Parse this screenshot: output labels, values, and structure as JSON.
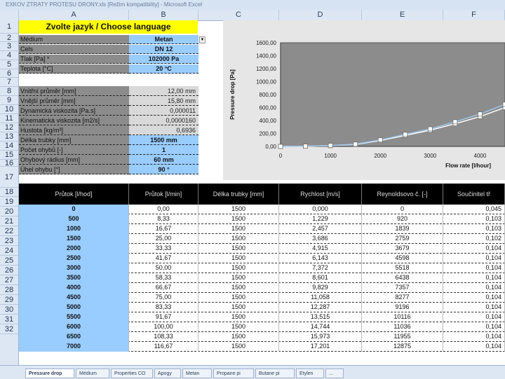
{
  "window_title": "EXKOV  ZTRATY  PROTESU  DRONY.xls [Režim kompatibility] - Microsoft Excel",
  "columns": [
    "A",
    "B",
    "C",
    "D",
    "E",
    "F"
  ],
  "row_numbers": [
    "1",
    "2",
    "3",
    "4",
    "5",
    "6",
    "7",
    "8",
    "9",
    "10",
    "11",
    "12",
    "13",
    "14",
    "15",
    "16",
    "17",
    "18",
    "19",
    "20",
    "21",
    "22",
    "23",
    "24",
    "25",
    "26",
    "27",
    "28",
    "29",
    "30",
    "31",
    "32"
  ],
  "language": {
    "title": "Zvolte jazyk /  Choose language"
  },
  "inputs": [
    {
      "label": "Médium",
      "value": "Metan"
    },
    {
      "label": "Cels",
      "value": "DN 12"
    },
    {
      "label": "Tlak [Pa] *",
      "value": "102000 Pa"
    },
    {
      "label": "Teplota [°C]",
      "value": "20 °C"
    }
  ],
  "props": [
    {
      "label": "Vnitřní průměr [mm]",
      "value": "12,00 mm"
    },
    {
      "label": "Vnější průměr [mm]",
      "value": "15,80 mm"
    },
    {
      "label": "Dynamická viskozita [Pa.s]",
      "value": "0,000011"
    },
    {
      "label": "Kinematická viskozita [m2/s]",
      "value": "0,0000160"
    },
    {
      "label": "Hustota [kg/m³]",
      "value": "0,6936"
    },
    {
      "label": "Délka trubky [mm]",
      "value": "1500 mm"
    },
    {
      "label": "Počet ohybů [-]",
      "value": "1"
    },
    {
      "label": "Ohybový rádius [mm]",
      "value": "60 mm"
    },
    {
      "label": "Úhel ohybu [°]",
      "value": "90 °"
    }
  ],
  "table": {
    "headers": [
      "Průtok [l/hod]",
      "Průtok [l/min]",
      "Délka trubky [mm]",
      "Rychlost [m/s]",
      "Reynoldsovo č. [-]",
      "Součinitel tř"
    ],
    "rows": [
      [
        "0",
        "0,00",
        "1500",
        "0,000",
        "0",
        "0,045"
      ],
      [
        "500",
        "8,33",
        "1500",
        "1,229",
        "920",
        "0,103"
      ],
      [
        "1000",
        "16,67",
        "1500",
        "2,457",
        "1839",
        "0,103"
      ],
      [
        "1500",
        "25,00",
        "1500",
        "3,686",
        "2759",
        "0,102"
      ],
      [
        "2000",
        "33,33",
        "1500",
        "4,915",
        "3679",
        "0,104"
      ],
      [
        "2500",
        "41,67",
        "1500",
        "6,143",
        "4598",
        "0,104"
      ],
      [
        "3000",
        "50,00",
        "1500",
        "7,372",
        "5518",
        "0,104"
      ],
      [
        "3500",
        "58,33",
        "1500",
        "8,601",
        "6438",
        "0,104"
      ],
      [
        "4000",
        "66,67",
        "1500",
        "9,829",
        "7357",
        "0,104"
      ],
      [
        "4500",
        "75,00",
        "1500",
        "11,058",
        "8277",
        "0,104"
      ],
      [
        "5000",
        "83,33",
        "1500",
        "12,287",
        "9196",
        "0,104"
      ],
      [
        "5500",
        "91,67",
        "1500",
        "13,515",
        "10116",
        "0,104"
      ],
      [
        "6000",
        "100,00",
        "1500",
        "14,744",
        "11036",
        "0,104"
      ],
      [
        "6500",
        "108,33",
        "1500",
        "15,973",
        "11955",
        "0,104"
      ],
      [
        "7000",
        "116,67",
        "1500",
        "17,201",
        "12875",
        "0,104"
      ]
    ]
  },
  "tabs": [
    "Pressure drop",
    "Médium",
    "Properties CO",
    "Apogy",
    "Metan",
    "Propane pi",
    "Butane pi",
    "Etylen",
    "..."
  ],
  "colors": {
    "label_bg": "#8c8c8c",
    "value_blue": "#99ccff",
    "lang_yellow": "#ffff00",
    "plot_bg": "#8c8c8c"
  },
  "chart_data": {
    "type": "line",
    "xlabel": "Flow rate [l/hour]",
    "ylabel": "Pressure drop [Pa]",
    "xlim": [
      0,
      4500
    ],
    "ylim": [
      0,
      1600
    ],
    "xticks": [
      "0",
      "1000",
      "2000",
      "3000",
      "4000"
    ],
    "yticks": [
      "0,00",
      "200,00",
      "400,00",
      "600,00",
      "800,00",
      "1000,00",
      "1200,00",
      "1400,00",
      "1600,00"
    ],
    "grid": false,
    "series": [
      {
        "x": [
          0,
          500,
          1000,
          1500,
          2000,
          2500,
          3000,
          3500,
          4000,
          4500
        ],
        "y": [
          0,
          3,
          12,
          30,
          90,
          170,
          250,
          350,
          460,
          600
        ]
      },
      {
        "x": [
          0,
          500,
          1000,
          1500,
          2000,
          2500,
          3000,
          3500,
          4000,
          4500
        ],
        "y": [
          0,
          4,
          14,
          35,
          100,
          185,
          270,
          380,
          500,
          650
        ]
      }
    ]
  }
}
